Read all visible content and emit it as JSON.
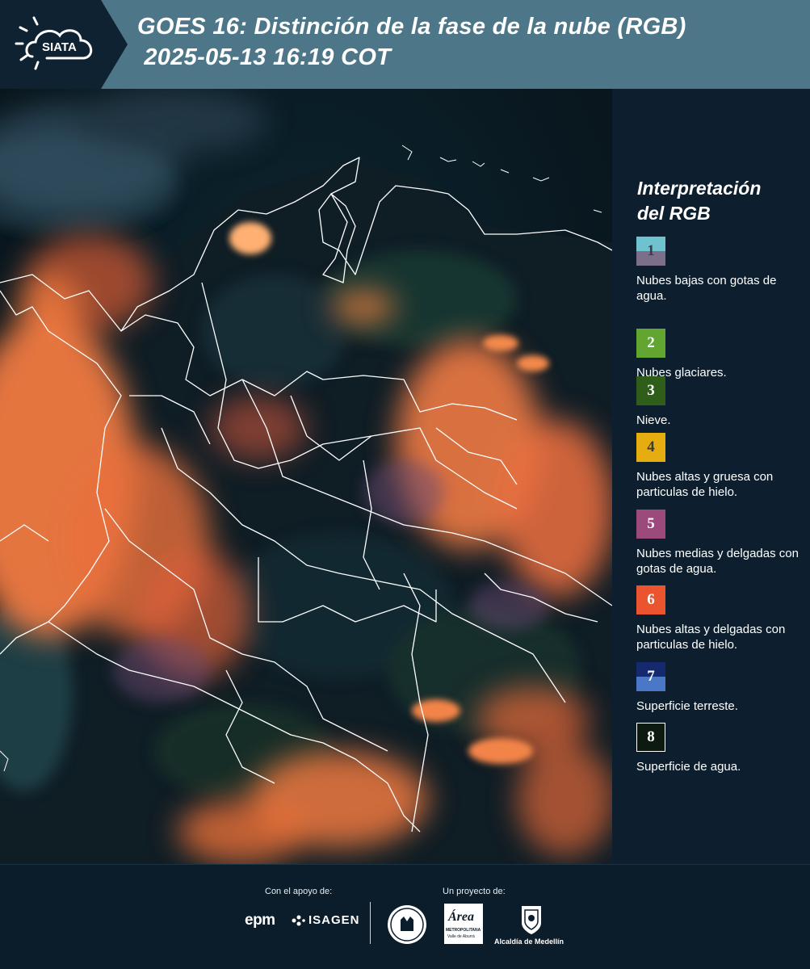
{
  "header": {
    "logo_text": "SIATA",
    "title": "GOES 16: Distinción de la fase de la nube (RGB)\n 2025-05-13 16:19 COT"
  },
  "legend": {
    "title": "Interpretación\ndel RGB",
    "items": [
      {
        "number": "1",
        "label": "Nubes bajas con gotas de agua.",
        "color_top": "#6fc3cf",
        "color_bottom": "#7c6f8c",
        "num_color": "#3e3a4c"
      },
      {
        "number": "2",
        "label": "Nubes glaciares.",
        "color_top": "#63a531",
        "color_bottom": "#63a531",
        "num_color": "#ffffff"
      },
      {
        "number": "3",
        "label": "Nieve.",
        "color_top": "#2e5e1a",
        "color_bottom": "#2e5e1a",
        "num_color": "#ffffff"
      },
      {
        "number": "4",
        "label": "Nubes altas y gruesa con particulas de hielo.",
        "color_top": "#e6ad10",
        "color_bottom": "#e6ad10",
        "num_color": "#3a3a3a"
      },
      {
        "number": "5",
        "label": "Nubes medias y delgadas con gotas de agua.",
        "color_top": "#9c4a7d",
        "color_bottom": "#9c4a7d",
        "num_color": "#ffffff"
      },
      {
        "number": "6",
        "label": "Nubes altas y delgadas con particulas de hielo.",
        "color_top": "#ea5530",
        "color_bottom": "#ea5530",
        "num_color": "#ffffff"
      },
      {
        "number": "7",
        "label": "Superficie terreste.",
        "color_top": "#152a6e",
        "color_bottom": "#4a78c6",
        "num_color": "#ffffff"
      },
      {
        "number": "8",
        "label": "Superficie de agua.",
        "color_top": "#0d1a10",
        "color_bottom": "#0d1a10",
        "num_color": "#ffffff"
      }
    ]
  },
  "footer": {
    "support_label": "Con el apoyo de:",
    "project_label": "Un proyecto de:",
    "epm": "epm",
    "isagen": "ISAGEN",
    "area_metro": "Área",
    "area_metro_sub": "METROPOLITANA",
    "area_metro_sub2": "Valle de Aburrá",
    "alcaldia": "Alcaldía de Medellín"
  },
  "colors": {
    "header_bg": "#4d7688",
    "logo_panel_bg": "#0e2232",
    "legend_bg": "#0d1f2e",
    "cloud_orange": "#f07a40",
    "land_dark": "#101e26"
  }
}
